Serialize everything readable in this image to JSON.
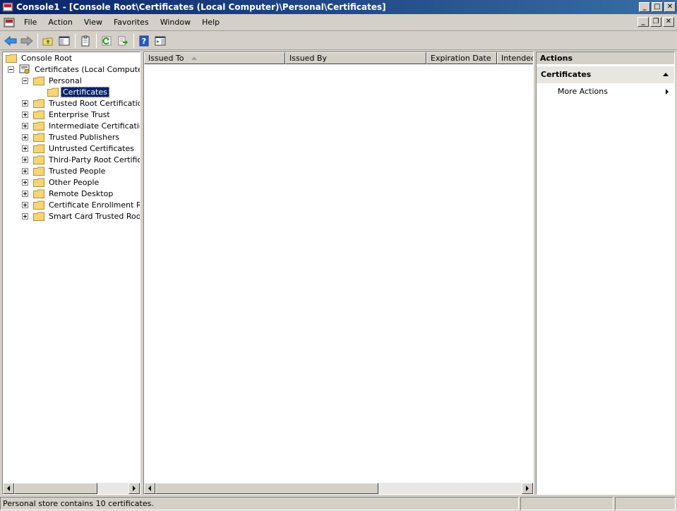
{
  "window": {
    "title": "Console1 - [Console Root\\Certificates (Local Computer)\\Personal\\Certificates]",
    "minimize": "_",
    "maximize": "□",
    "close": "✕"
  },
  "mdi": {
    "minimize": "_",
    "restore": "❐",
    "close": "✕"
  },
  "menu": {
    "items": [
      "File",
      "Action",
      "View",
      "Favorites",
      "Window",
      "Help"
    ]
  },
  "toolbar": {
    "icons": [
      "back-arrow-icon",
      "forward-arrow-icon",
      "up-folder-icon",
      "show-hide-tree-icon",
      "clipboard-icon",
      "refresh-icon",
      "export-list-icon",
      "help-icon",
      "show-hide-action-pane-icon"
    ]
  },
  "tree": {
    "root": "Console Root",
    "computer": "Certificates (Local Computer)",
    "personal": "Personal",
    "selected": "Certificates",
    "stores": [
      "Trusted Root Certification A",
      "Enterprise Trust",
      "Intermediate Certification A",
      "Trusted Publishers",
      "Untrusted Certificates",
      "Third-Party Root Certificatio",
      "Trusted People",
      "Other People",
      "Remote Desktop",
      "Certificate Enrollment Requ",
      "Smart Card Trusted Roots"
    ]
  },
  "list": {
    "columns": [
      "Issued To",
      "Issued By",
      "Expiration Date",
      "Intended"
    ]
  },
  "actions": {
    "header": "Actions",
    "section": "Certificates",
    "items": [
      "More Actions"
    ]
  },
  "status": {
    "text": "Personal store contains 10 certificates."
  },
  "colors": {
    "title_bar": "#0a246a",
    "selection": "#0a246a",
    "chrome": "#d4d0c8",
    "folder": "#f6d478"
  }
}
